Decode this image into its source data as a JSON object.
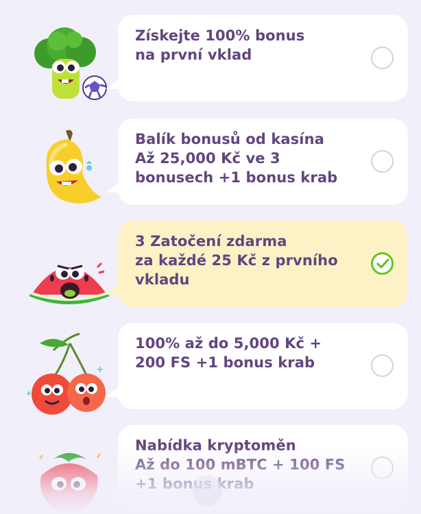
{
  "offers": [
    {
      "text": "Získejte 100% bonus\nna první vklad",
      "selected": false,
      "mascot_icon": "broccoli-soccer-icon"
    },
    {
      "text": "Balík bonusů od kasína\nAž 25,000 Kč ve 3\nbonusech +1 bonus krab",
      "selected": false,
      "mascot_icon": "banana-icon"
    },
    {
      "text": "3 Zatočení zdarma\nza každé 25 Kč z prvního\nvkladu",
      "selected": true,
      "mascot_icon": "watermelon-icon"
    },
    {
      "text": "100% až do 5,000 Kč +\n200 FS +1 bonus krab",
      "selected": false,
      "mascot_icon": "cherries-icon"
    },
    {
      "text": "Nabídka kryptoměn\nAž do 100 mBTC + 100 FS\n+1 bonus krab",
      "selected": false,
      "mascot_icon": "strawberry-icon"
    }
  ],
  "colors": {
    "background": "#f1effa",
    "card": "#ffffff",
    "card_selected": "#fdf2c6",
    "text": "#62457e",
    "radio_border": "#d4d0de",
    "check": "#64c32a"
  }
}
